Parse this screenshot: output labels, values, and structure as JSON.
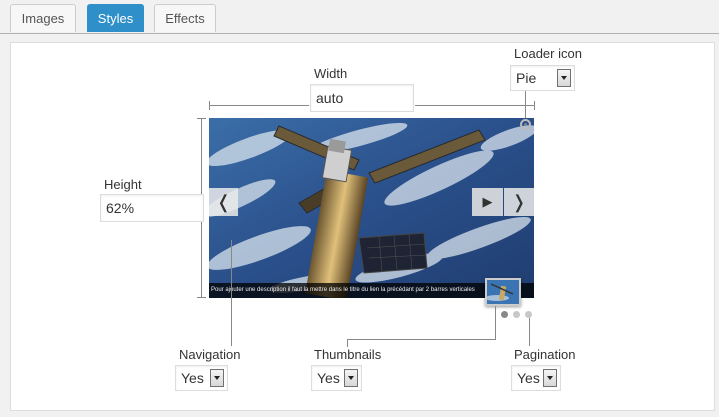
{
  "tabs": [
    {
      "label": "Images",
      "active": false
    },
    {
      "label": "Styles",
      "active": true
    },
    {
      "label": "Effects",
      "active": false
    }
  ],
  "colors": {
    "active_tab": "#2e8fc9",
    "panel_bg": "#ffffff",
    "page_bg": "#f1f1f1"
  },
  "width": {
    "label": "Width",
    "value": "auto"
  },
  "height": {
    "label": "Height",
    "value": "62%"
  },
  "loader_icon": {
    "label": "Loader icon",
    "selected": "Pie"
  },
  "navigation": {
    "label": "Navigation",
    "selected": "Yes"
  },
  "thumbnails": {
    "label": "Thumbnails",
    "selected": "Yes"
  },
  "pagination": {
    "label": "Pagination",
    "selected": "Yes",
    "dot_count": 3,
    "active_index": 0
  },
  "slider": {
    "caption": "Pour ajouter une description il faut la mettre dans le titre du lien la précédant par 2 barres verticales",
    "prev_icon": "chevron-left-icon",
    "play_icon": "play-icon",
    "next_icon": "chevron-right-icon",
    "image_subject": "space-station-over-earth"
  }
}
